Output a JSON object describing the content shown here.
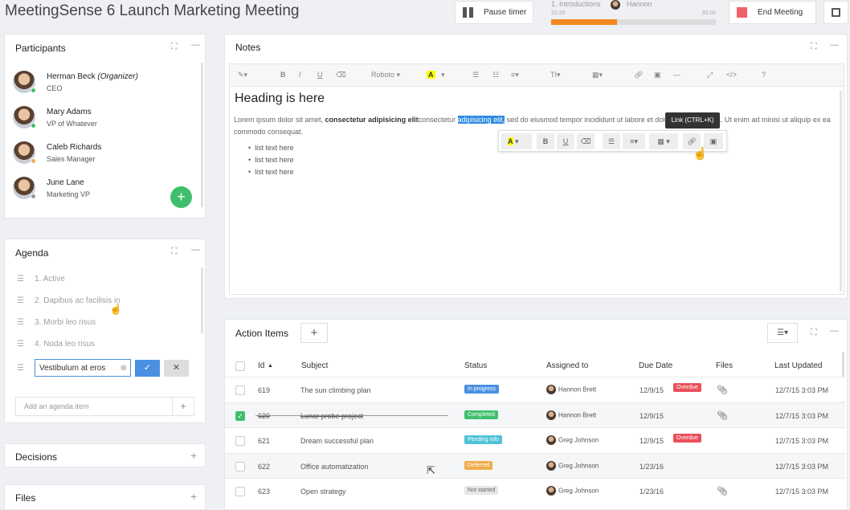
{
  "app": {
    "title": "MeetingSense 6 Launch Marketing Meeting"
  },
  "topbar": {
    "pause_label": "Pause timer",
    "agenda_item": "1. Introductions",
    "speaker": "Hannon",
    "time_start": "22:33",
    "time_end": "30:00",
    "progress": 0.4,
    "end_label": "End Meeting"
  },
  "participants": {
    "title": "Participants",
    "list": [
      {
        "name": "Herman Beck",
        "tag": "(Organizer)",
        "role": "CEO",
        "status_color": "#3fbf6e"
      },
      {
        "name": "Mary Adams",
        "tag": "",
        "role": "VP of Whatever",
        "status_color": "#3fbf6e"
      },
      {
        "name": "Caleb Richards",
        "tag": "",
        "role": "Sales Manager",
        "status_color": "#f0ad4e"
      },
      {
        "name": "June Lane",
        "tag": "",
        "role": "Marketing VP",
        "status_color": "#999999"
      }
    ]
  },
  "agenda": {
    "title": "Agenda",
    "items": [
      "1. Active",
      "2. Dapibus ac facilisis in",
      "3. Morbi leo risus",
      "4. Noda leo risus"
    ],
    "edit_value": "Vestibulum at eros",
    "add_placeholder": "Add an agenda item"
  },
  "decisions": {
    "title": "Decisions"
  },
  "files": {
    "title": "Files"
  },
  "notes": {
    "title": "Notes",
    "font": "Roboto",
    "heading": "Heading is here",
    "para_a": "Lorem ipsum dolor sit amet, ",
    "para_bold": "consectetur adipisicing elit",
    "para_b": "consectetur ",
    "para_sel": "adipisicing elit,",
    "para_c": " sed do eiusmod tempor incididunt ut labore et dolore magna aliqua. Ut enim ad minisi ut aliquip ex ea commodo consequat.",
    "bullets": [
      "list text here",
      "list text here",
      "list text here"
    ],
    "tooltip": "Link (CTRL+K)"
  },
  "actions": {
    "title": "Action Items",
    "columns": [
      "Id",
      "Subject",
      "Status",
      "Assigned to",
      "Due Date",
      "Files",
      "Last Updated"
    ],
    "rows": [
      {
        "id": "619",
        "subject": "The sun climbing plan",
        "status": "In progress",
        "status_color": "#4a90e2",
        "assignee": "Hannon Brett",
        "due": "12/9/15",
        "overdue": "Overdue",
        "file": true,
        "updated": "12/7/15 3:03 PM",
        "checked": false
      },
      {
        "id": "620",
        "subject": "Lunar probe project",
        "status": "Completed",
        "status_color": "#3fbf6e",
        "assignee": "Hannon Brett",
        "due": "12/9/15",
        "overdue": "",
        "file": true,
        "updated": "12/7/15 3:03 PM",
        "checked": true
      },
      {
        "id": "621",
        "subject": "Dream successful plan",
        "status": "Pending info",
        "status_color": "#4ec3d6",
        "assignee": "Greg Johnson",
        "due": "12/9/15",
        "overdue": "Overdue",
        "file": false,
        "updated": "12/7/15 3:03 PM",
        "checked": false
      },
      {
        "id": "622",
        "subject": "Office automatization",
        "status": "Deferred",
        "status_color": "#f0ad4e",
        "assignee": "Greg Johnson",
        "due": "1/23/16",
        "overdue": "",
        "file": false,
        "updated": "12/7/15 3:03 PM",
        "checked": false
      },
      {
        "id": "623",
        "subject": "Open strategy",
        "status": "Not started",
        "status_color": "#e6e6e6",
        "assignee": "Greg Johnson",
        "due": "1/23/16",
        "overdue": "",
        "file": true,
        "updated": "12/7/15 3:03 PM",
        "checked": false
      }
    ]
  }
}
